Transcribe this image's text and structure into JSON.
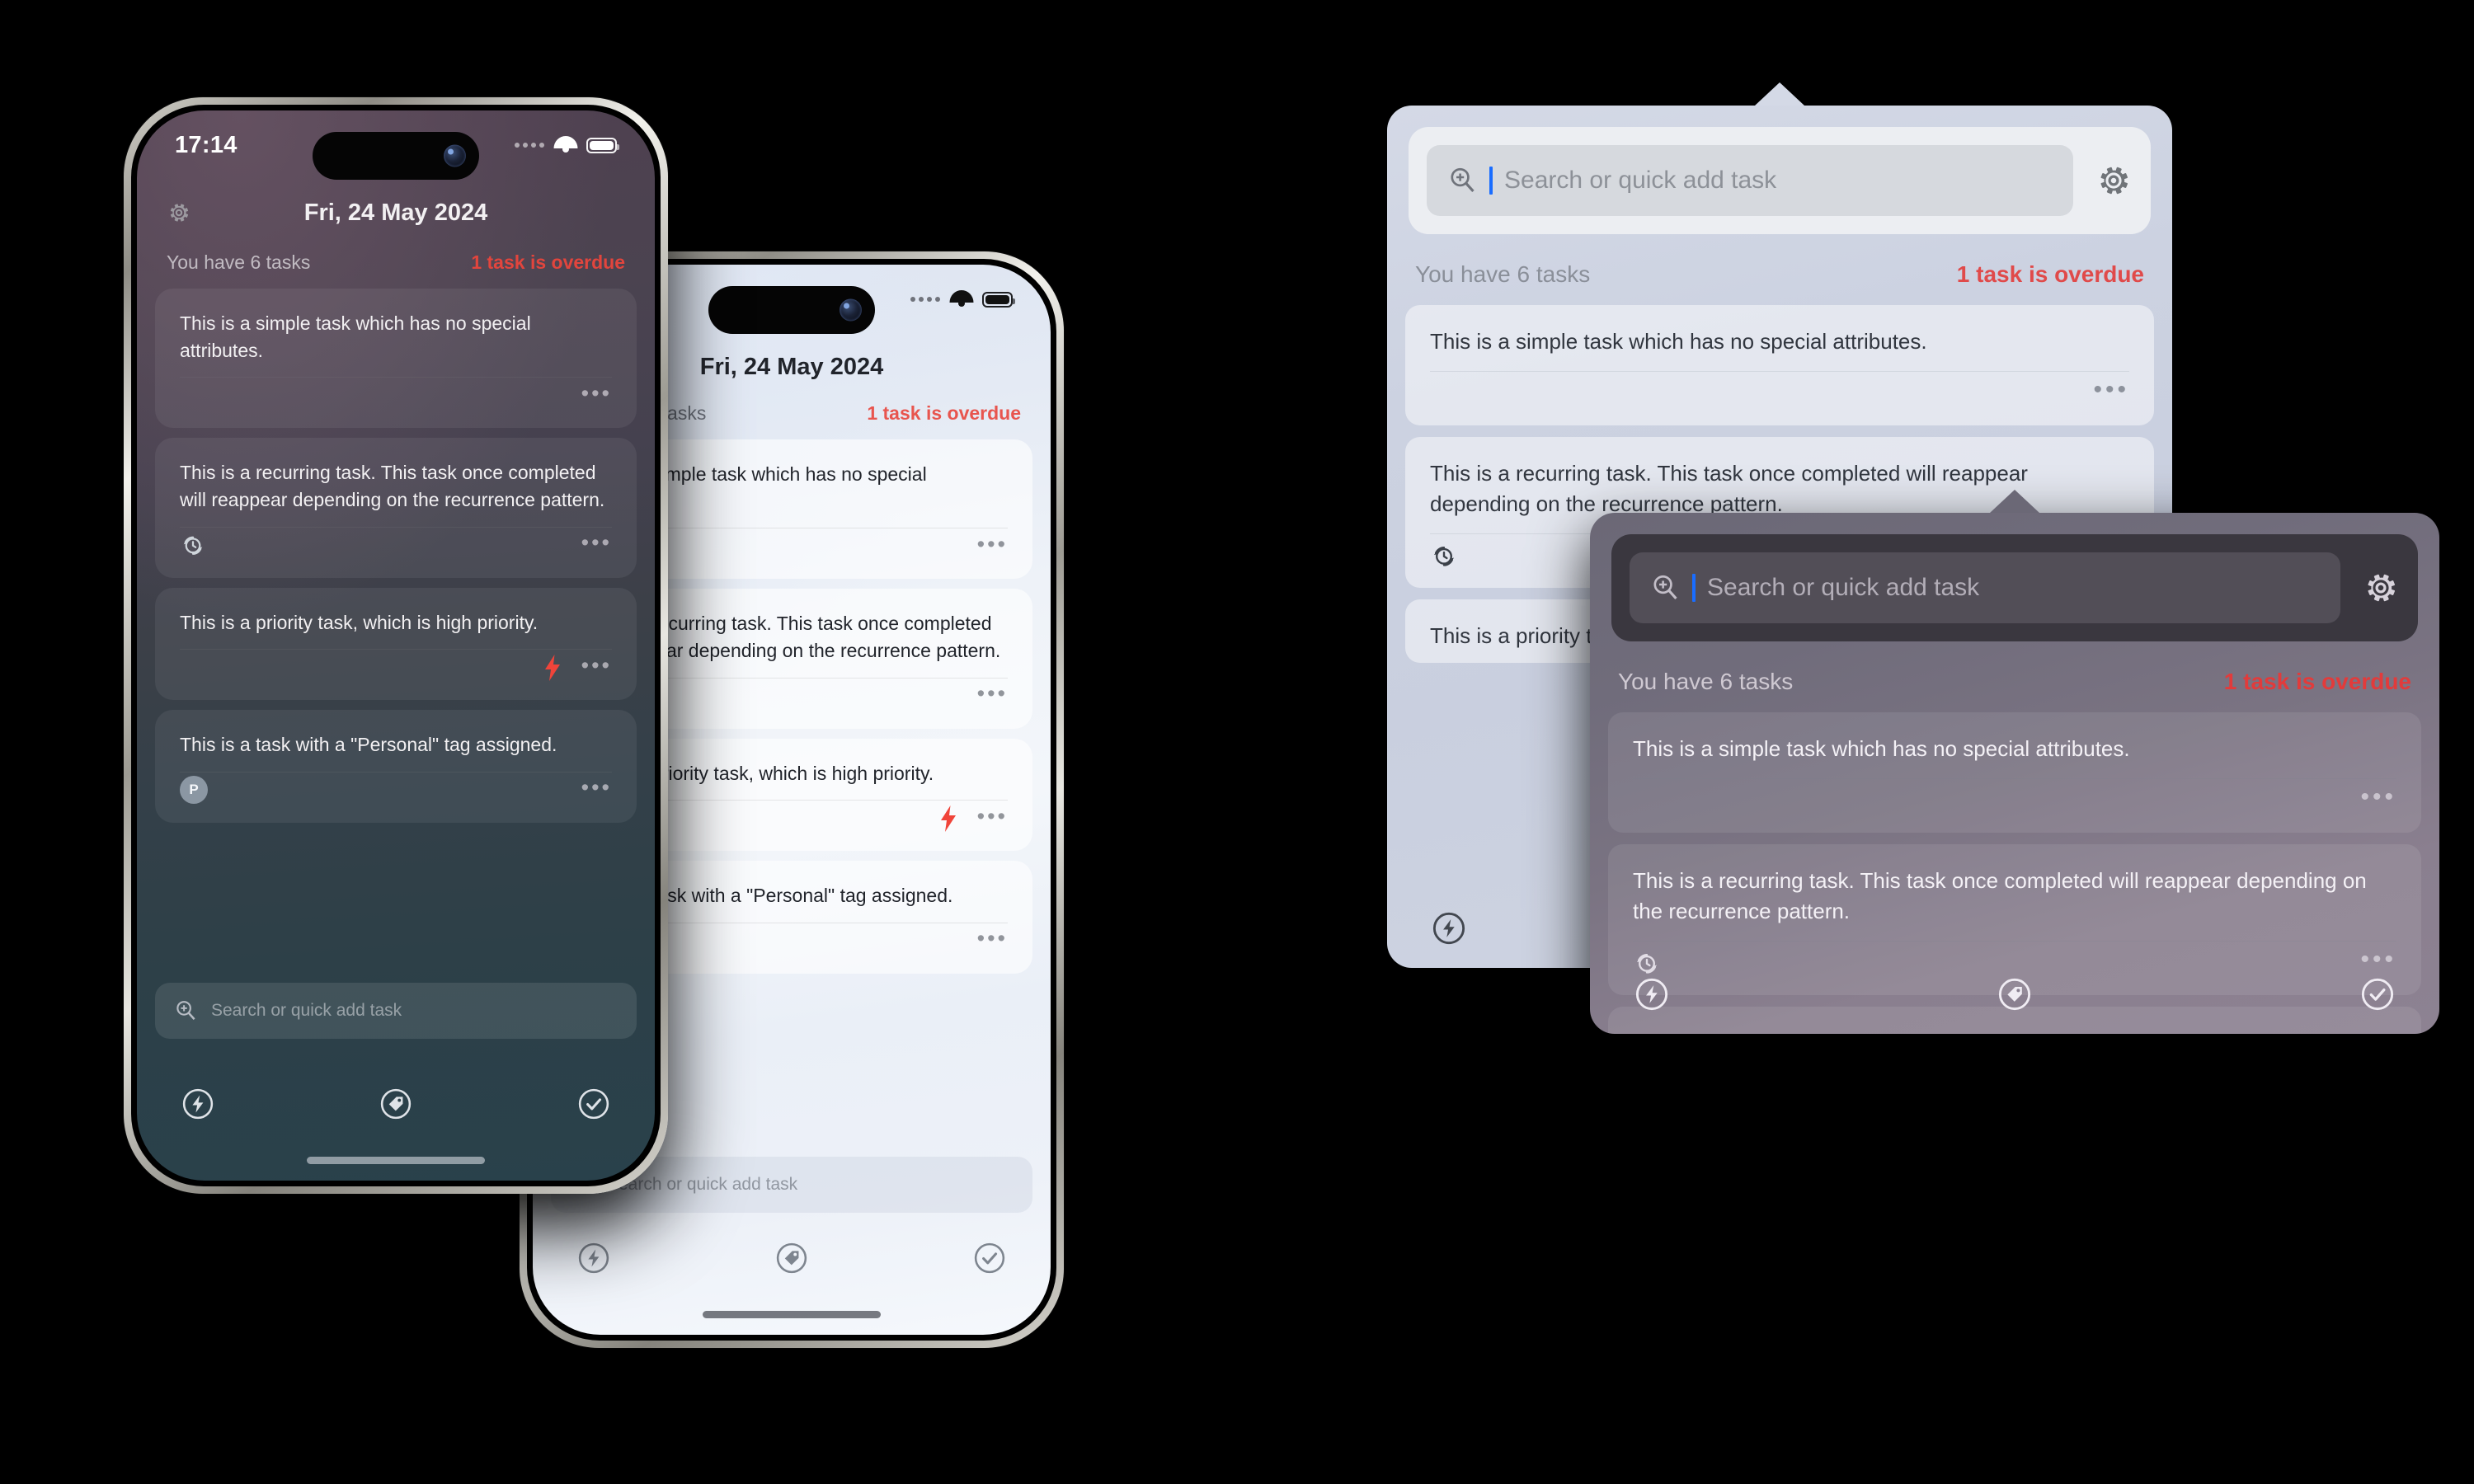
{
  "app": {
    "date_title": "Fri, 24 May 2024",
    "status_time": "17:14",
    "task_count_label": "You have 6 tasks",
    "overdue_label": "1 task is overdue",
    "overdue_color": "#e23b3b",
    "overdue_color_light": "#e04a4a",
    "search_placeholder": "Search or quick add task",
    "tag_badge_letter": "P",
    "more_dots": "•••",
    "caret_color": "#1a6dff"
  },
  "tasks": [
    {
      "text": "This is a simple task which has no special attributes.",
      "icon": "none"
    },
    {
      "text": "This is a recurring task. This task once completed will reappear depending on the recurrence pattern.",
      "icon": "recurrence-icon"
    },
    {
      "text": "This is a priority task, which is high priority.",
      "icon": "priority-bolt-icon"
    },
    {
      "text": "This is a task with a \"Personal\" tag assigned.",
      "icon": "tag-badge"
    }
  ],
  "tabs": [
    {
      "name": "priority-tab",
      "icon": "bolt-circle-icon"
    },
    {
      "name": "tags-tab",
      "icon": "tag-circle-icon"
    },
    {
      "name": "completed-tab",
      "icon": "check-circle-icon"
    }
  ],
  "icons": {
    "settings": "gear-icon",
    "search": "magnifier-plus-icon",
    "wifi": "wifi-icon",
    "battery": "battery-icon",
    "signal": "signal-dots-icon"
  },
  "surfaces": {
    "phone_dark": {
      "name": "dark-theme-phone"
    },
    "phone_light": {
      "name": "light-theme-phone"
    },
    "widget_light": {
      "name": "light-theme-desktop-widget"
    },
    "widget_dark": {
      "name": "dark-theme-desktop-widget"
    }
  }
}
